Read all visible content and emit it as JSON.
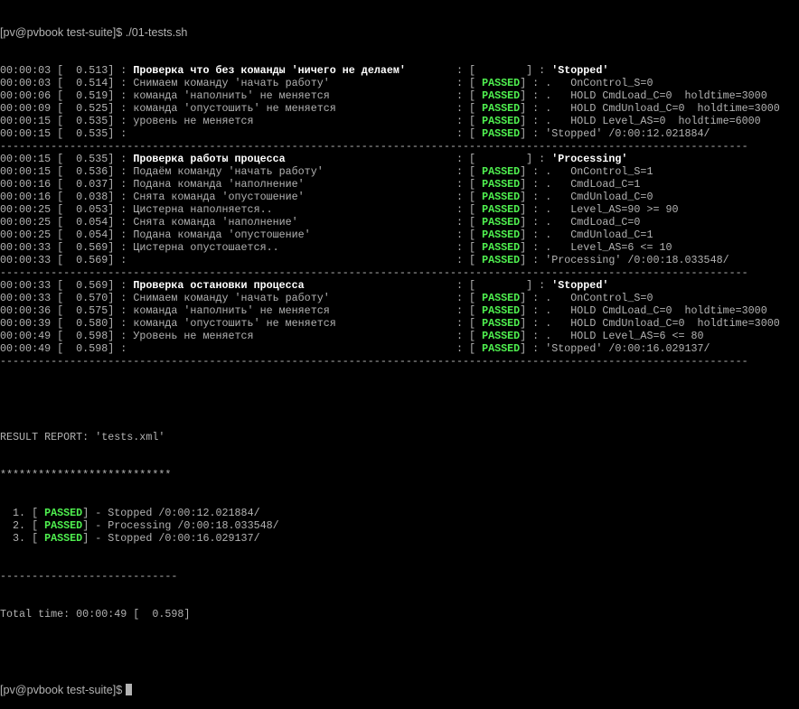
{
  "prompt": {
    "text": "[pv@pvbook test-suite]$ ",
    "command": "./01-tests.sh"
  },
  "separator": "----------------------------------------------------------------------------------------------------------------------",
  "passed_label": "PASSED",
  "check_marker": ".",
  "sections": [
    {
      "header": {
        "time": "00:00:03",
        "elapsed": "0.513",
        "title": "Проверка что без команды 'ничего не делаем'",
        "state": "'Stopped'"
      },
      "checks": [
        {
          "time": "00:00:03",
          "elapsed": "0.514",
          "message": "Снимаем команду 'начать работу'",
          "detail": "OnControl_S=0"
        },
        {
          "time": "00:00:06",
          "elapsed": "0.519",
          "message": "команда 'наполнить' не меняется",
          "detail": "HOLD CmdLoad_C=0  holdtime=3000"
        },
        {
          "time": "00:00:09",
          "elapsed": "0.525",
          "message": "команда 'опустошить' не меняется",
          "detail": "HOLD CmdUnload_C=0  holdtime=3000"
        },
        {
          "time": "00:00:15",
          "elapsed": "0.535",
          "message": "уровень не меняется",
          "detail": "HOLD Level_AS=0  holdtime=6000"
        }
      ],
      "footer": {
        "time": "00:00:15",
        "elapsed": "0.535",
        "result": "'Stopped' /0:00:12.021884/"
      }
    },
    {
      "header": {
        "time": "00:00:15",
        "elapsed": "0.535",
        "title": "Проверка работы процесса",
        "state": "'Processing'"
      },
      "checks": [
        {
          "time": "00:00:15",
          "elapsed": "0.536",
          "message": "Подаём команду 'начать работу'",
          "detail": "OnControl_S=1"
        },
        {
          "time": "00:00:16",
          "elapsed": "0.037",
          "message": "Подана команда 'наполнение'",
          "detail": "CmdLoad_C=1"
        },
        {
          "time": "00:00:16",
          "elapsed": "0.038",
          "message": "Снята команда 'опустошение'",
          "detail": "CmdUnload_C=0"
        },
        {
          "time": "00:00:25",
          "elapsed": "0.053",
          "message": "Цистерна наполняется..",
          "detail": "Level_AS=90 >= 90"
        },
        {
          "time": "00:00:25",
          "elapsed": "0.054",
          "message": "Снята команда 'наполнение'",
          "detail": "CmdLoad_C=0"
        },
        {
          "time": "00:00:25",
          "elapsed": "0.054",
          "message": "Подана команда 'опустошение'",
          "detail": "CmdUnload_C=1"
        },
        {
          "time": "00:00:33",
          "elapsed": "0.569",
          "message": "Цистерна опустошается..",
          "detail": "Level_AS=6 <= 10"
        }
      ],
      "footer": {
        "time": "00:00:33",
        "elapsed": "0.569",
        "result": "'Processing' /0:00:18.033548/"
      }
    },
    {
      "header": {
        "time": "00:00:33",
        "elapsed": "0.569",
        "title": "Проверка остановки процесса",
        "state": "'Stopped'"
      },
      "checks": [
        {
          "time": "00:00:33",
          "elapsed": "0.570",
          "message": "Снимаем команду 'начать работу'",
          "detail": "OnControl_S=0"
        },
        {
          "time": "00:00:36",
          "elapsed": "0.575",
          "message": "команда 'наполнить' не меняется",
          "detail": "HOLD CmdLoad_C=0  holdtime=3000"
        },
        {
          "time": "00:00:39",
          "elapsed": "0.580",
          "message": "команда 'опустошить' не меняется",
          "detail": "HOLD CmdUnload_C=0  holdtime=3000"
        },
        {
          "time": "00:00:49",
          "elapsed": "0.598",
          "message": "Уровень не меняется",
          "detail": "HOLD Level_AS=6 <= 80"
        }
      ],
      "footer": {
        "time": "00:00:49",
        "elapsed": "0.598",
        "result": "'Stopped' /0:00:16.029137/"
      }
    }
  ],
  "report": {
    "title": "RESULT REPORT: 'tests.xml'",
    "stars": "***************************",
    "items": [
      {
        "num": "1.",
        "status": "PASSED",
        "text": "Stopped /0:00:12.021884/"
      },
      {
        "num": "2.",
        "status": "PASSED",
        "text": "Processing /0:00:18.033548/"
      },
      {
        "num": "3.",
        "status": "PASSED",
        "text": "Stopped /0:00:16.029137/"
      }
    ],
    "dashes": "----------------------------",
    "total_label": "Total time: ",
    "total_time": "00:00:49",
    "total_elapsed": "0.598"
  },
  "final_prompt": "[pv@pvbook test-suite]$"
}
